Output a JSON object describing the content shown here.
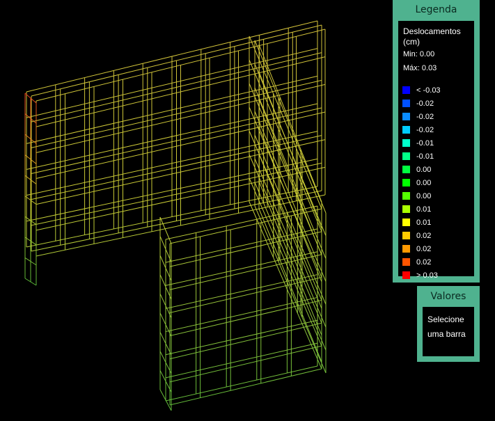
{
  "legend": {
    "title": "Legenda",
    "heading": "Deslocamentos (cm)",
    "min": "Min: 0.00",
    "max": "Máx: 0.03",
    "items": [
      {
        "label": "< -0.03",
        "color": "#0000ff"
      },
      {
        "label": "-0.02",
        "color": "#0050ff"
      },
      {
        "label": "-0.02",
        "color": "#0a8cff"
      },
      {
        "label": "-0.02",
        "color": "#00ccff"
      },
      {
        "label": "-0.01",
        "color": "#00ffcc"
      },
      {
        "label": "-0.01",
        "color": "#00ff88"
      },
      {
        "label": "0.00",
        "color": "#00ff40"
      },
      {
        "label": "0.00",
        "color": "#00ff00"
      },
      {
        "label": "0.00",
        "color": "#55ff00"
      },
      {
        "label": "0.01",
        "color": "#aaff00"
      },
      {
        "label": "0.01",
        "color": "#ffff00"
      },
      {
        "label": "0.02",
        "color": "#ffcc00"
      },
      {
        "label": "0.02",
        "color": "#ff9900"
      },
      {
        "label": "0.02",
        "color": "#ff5500"
      },
      {
        "label": "> 0.03",
        "color": "#ff0000"
      }
    ]
  },
  "values": {
    "title": "Valores",
    "line1": "Selecione",
    "line2": "uma barra"
  }
}
